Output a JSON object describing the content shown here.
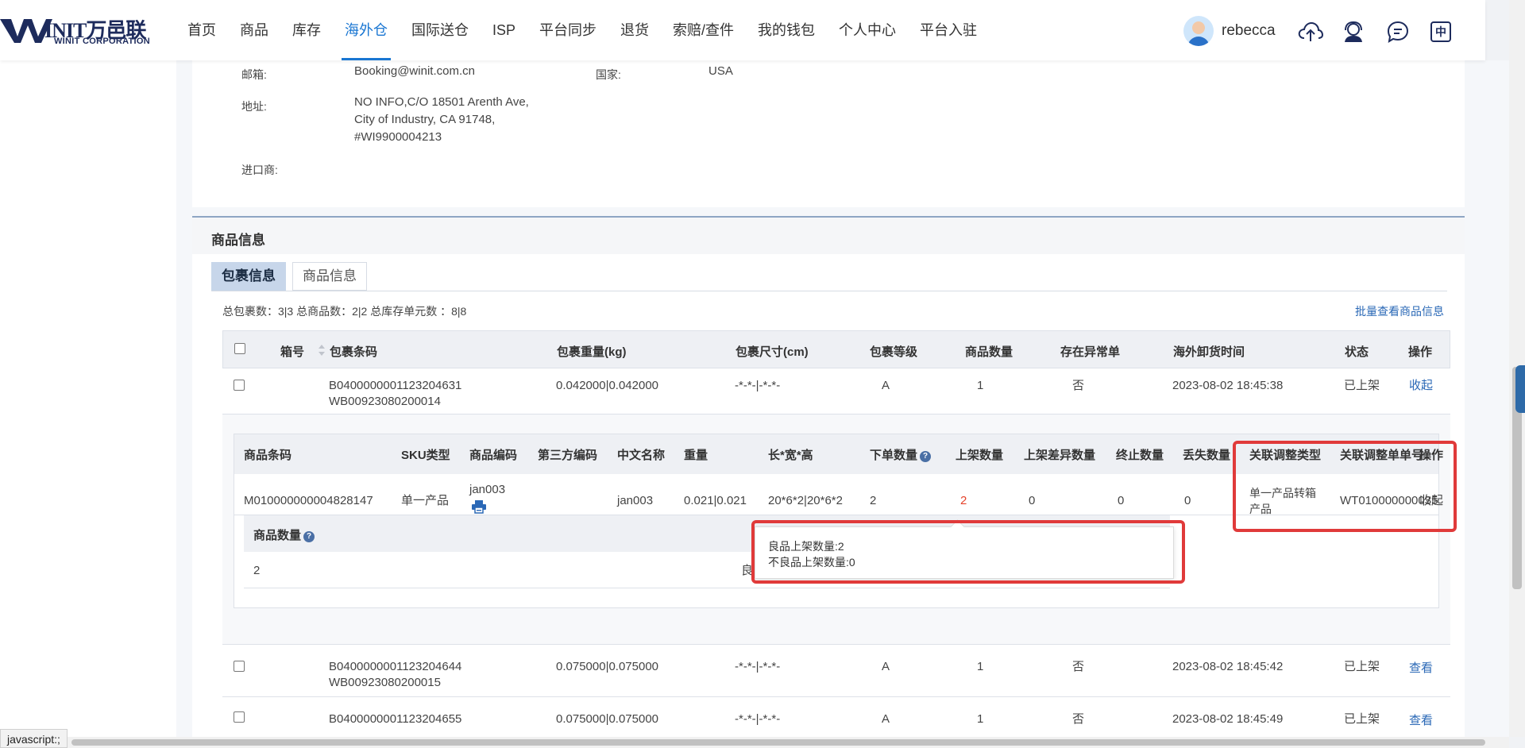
{
  "brand": {
    "name": "INIT万邑联",
    "sub": "WINIT CORPORATION"
  },
  "nav": [
    "首页",
    "商品",
    "库存",
    "海外仓",
    "国际送仓",
    "ISP",
    "平台同步",
    "退货",
    "索赔/查件",
    "我的钱包",
    "个人中心",
    "平台入驻"
  ],
  "user": {
    "name": "rebecca",
    "lang": "中"
  },
  "address": {
    "email_label": "邮箱:",
    "email": "Booking@winit.com.cn",
    "country_label": "国家:",
    "country": "USA",
    "address_label": "地址:",
    "address_lines": [
      "NO INFO,C/O 18501 Arenth Ave,",
      "City of Industry, CA 91748,",
      "#WI9900004213"
    ],
    "importer_label": "进口商:"
  },
  "section": {
    "title": "商品信息",
    "tabs": [
      "包裹信息",
      "商品信息"
    ],
    "summary": "总包裹数：3|3 总商品数：2|2 总库存单元数 ：8|8",
    "batch_link": "批量查看商品信息"
  },
  "pkg_headers": [
    "箱号",
    "包裹条码",
    "包裹重量(kg)",
    "包裹尺寸(cm)",
    "包裹等级",
    "商品数量",
    "存在异常单",
    "海外卸货时间",
    "状态",
    "操作"
  ],
  "packages": [
    {
      "barcode": "B0400000001123204631",
      "sub_barcode": "WB00923080200014",
      "weight": "0.042000|0.042000",
      "size": "-*-*-|-*-*-",
      "grade": "A",
      "qty": "1",
      "abnormal": "否",
      "time": "2023-08-02 18:45:38",
      "status": "已上架",
      "action": "收起"
    },
    {
      "barcode": "B0400000001123204644",
      "sub_barcode": "WB00923080200015",
      "weight": "0.075000|0.075000",
      "size": "-*-*-|-*-*-",
      "grade": "A",
      "qty": "1",
      "abnormal": "否",
      "time": "2023-08-02 18:45:42",
      "status": "已上架",
      "action": "查看"
    },
    {
      "barcode": "B0400000001123204655",
      "sub_barcode": "",
      "weight": "0.075000|0.075000",
      "size": "-*-*-|-*-*-",
      "grade": "A",
      "qty": "1",
      "abnormal": "否",
      "time": "2023-08-02 18:45:49",
      "status": "已上架",
      "action": "查看"
    }
  ],
  "item_headers": [
    "商品条码",
    "SKU类型",
    "商品编码",
    "第三方编码",
    "中文名称",
    "重量",
    "长*宽*高",
    "下单数量",
    "上架数量",
    "上架差异数量",
    "终止数量",
    "丢失数量",
    "关联调整类型",
    "关联调整单单号",
    "操作"
  ],
  "item": {
    "barcode": "M010000000004828147",
    "sku_type": "单一产品",
    "code": "jan003",
    "third_code": "",
    "cn_name": "jan003",
    "weight": "0.021|0.021",
    "dims": "20*6*2|20*6*2",
    "order_qty": "2",
    "shelf_qty": "2",
    "diff_qty": "0",
    "stop_qty": "0",
    "lost_qty": "0",
    "adjust_type_line1": "单一产品转箱",
    "adjust_type_line2": "产品",
    "adjust_no": "WT010000000035",
    "action": "收起"
  },
  "qty_sub": {
    "header": "商品数量",
    "value": "2",
    "quality": "良品"
  },
  "tooltip": {
    "line1": "良品上架数量:2",
    "line2": "不良品上架数量:0"
  },
  "status_text": "javascript:;"
}
